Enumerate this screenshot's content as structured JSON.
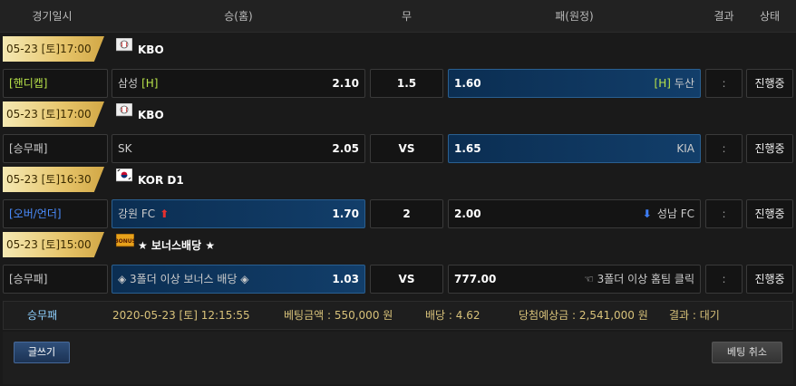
{
  "columns": {
    "datetime": "경기일시",
    "home": "승(홈)",
    "draw": "무",
    "away": "패(원정)",
    "result": "결과",
    "status": "상태"
  },
  "games": [
    {
      "date": "05-23 [토]17:00",
      "league": "KBO",
      "flag_icon": "baseball-flag-icon",
      "type": "[핸디캡]",
      "type_color": "#b8e34a",
      "home_team": "삼성",
      "home_mark": "[H]",
      "home_odds": "2.10",
      "draw": "1.5",
      "away_odds": "1.60",
      "away_mark": "[H]",
      "away_team": "두산",
      "result": ":",
      "status": "진행중",
      "highlight": "away"
    },
    {
      "date": "05-23 [토]17:00",
      "league": "KBO",
      "flag_icon": "baseball-flag-icon",
      "type": "[승무패]",
      "type_color": "#cccccc",
      "home_team": "SK",
      "home_mark": "",
      "home_odds": "2.05",
      "draw": "VS",
      "away_odds": "1.65",
      "away_mark": "",
      "away_team": "KIA",
      "result": ":",
      "status": "진행중",
      "highlight": "away"
    },
    {
      "date": "05-23 [토]16:30",
      "league": "KOR D1",
      "flag_icon": "korea-flag-icon",
      "type": "[오버/언더]",
      "type_color": "#4b8dff",
      "home_team": "강원 FC",
      "home_mark": "",
      "home_odds": "1.70",
      "draw": "2",
      "away_odds": "2.00",
      "away_mark": "",
      "away_team": "성남 FC",
      "result": ":",
      "status": "진행중",
      "highlight": "home",
      "home_arrow": "up",
      "away_arrow": "down"
    },
    {
      "date": "05-23 [토]15:00",
      "league": "★ 보너스배당 ★",
      "flag_icon": "bonus-badge-icon",
      "type": "[승무패]",
      "type_color": "#cccccc",
      "home_team": "◈ 3폴더 이상 보너스 배당 ◈",
      "home_mark": "",
      "home_odds": "1.03",
      "draw": "VS",
      "away_odds": "777.00",
      "away_mark": "",
      "away_team": "☜ 3폴더 이상 홈팀 클릭",
      "result": ":",
      "status": "진행중",
      "highlight": "home"
    }
  ],
  "summary": {
    "type": "승무패",
    "datetime": "2020-05-23 [토] 12:15:55",
    "bet_amount": "베팅금액 : 550,000 원",
    "odds": "배당 : 4.62",
    "expected_win": "당첨예상금 : 2,541,000 원",
    "result": "결과 : 대기"
  },
  "footer": {
    "write_label": "글쓰기",
    "cancel_label": "베팅 취소"
  }
}
